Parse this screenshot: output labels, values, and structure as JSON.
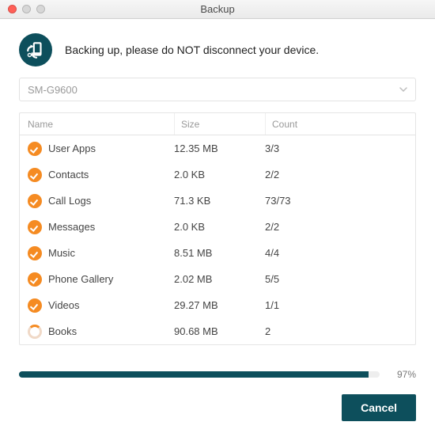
{
  "window": {
    "title": "Backup"
  },
  "header": {
    "message": "Backing up, please do NOT disconnect your device."
  },
  "device": {
    "selected": "SM-G9600"
  },
  "columns": {
    "name": "Name",
    "size": "Size",
    "count": "Count"
  },
  "rows": [
    {
      "status": "done",
      "name": "User Apps",
      "size": "12.35 MB",
      "count": "3/3"
    },
    {
      "status": "done",
      "name": "Contacts",
      "size": "2.0 KB",
      "count": "2/2"
    },
    {
      "status": "done",
      "name": "Call Logs",
      "size": "71.3 KB",
      "count": "73/73"
    },
    {
      "status": "done",
      "name": "Messages",
      "size": "2.0 KB",
      "count": "2/2"
    },
    {
      "status": "done",
      "name": "Music",
      "size": "8.51 MB",
      "count": "4/4"
    },
    {
      "status": "done",
      "name": "Phone Gallery",
      "size": "2.02 MB",
      "count": "5/5"
    },
    {
      "status": "done",
      "name": "Videos",
      "size": "29.27 MB",
      "count": "1/1"
    },
    {
      "status": "working",
      "name": "Books",
      "size": "90.68 MB",
      "count": "2"
    }
  ],
  "progress": {
    "percent": 97,
    "label": "97%"
  },
  "buttons": {
    "cancel": "Cancel"
  },
  "colors": {
    "accent": "#0d4f5c",
    "status_done": "#f58b22"
  }
}
